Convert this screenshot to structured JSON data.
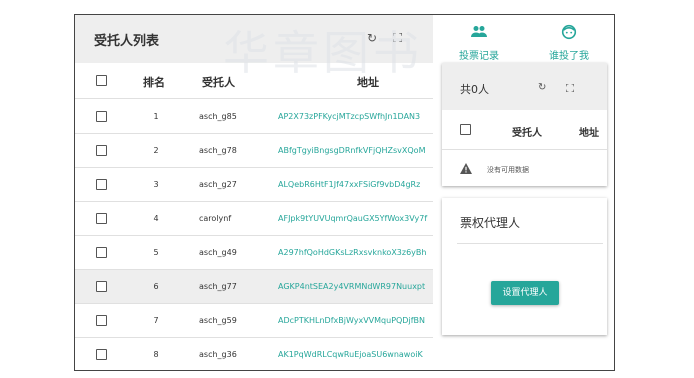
{
  "delegates": {
    "title": "受托人列表",
    "refresh_icon": "↻",
    "watermark": "华章图书",
    "columns": {
      "rank": "排名",
      "name": "受托人",
      "address": "地址"
    },
    "rows": [
      {
        "rank": "1",
        "name": "asch_g85",
        "address": "AP2X73zPFKycjMTzcpSWfhJn1DAN3"
      },
      {
        "rank": "2",
        "name": "asch_g78",
        "address": "ABfgTgyiBngsgDRnfkVFjQHZsvXQoM"
      },
      {
        "rank": "3",
        "name": "asch_g27",
        "address": "ALQebR6HtF1Jf47xxFSiGf9vbD4gRz"
      },
      {
        "rank": "4",
        "name": "carolynf",
        "address": "AFJpk9tYUVUqmrQauGX5YfWox3Vy7f"
      },
      {
        "rank": "5",
        "name": "asch_g49",
        "address": "A297hfQoHdGKsLzRxsvknkoX3z6yBh"
      },
      {
        "rank": "6",
        "name": "asch_g77",
        "address": "AGKP4ntSEA2y4VRMNdWR97Nuuxpt"
      },
      {
        "rank": "7",
        "name": "asch_g59",
        "address": "ADcPTKHLnDfxBjWyxVVMquPQDjfBN"
      },
      {
        "rank": "8",
        "name": "asch_g36",
        "address": "AK1PqWdRLCqwRuEjoaSU6wnawoiK"
      }
    ]
  },
  "tabs": [
    {
      "label": "投票记录",
      "icon": "people-icon"
    },
    {
      "label": "谁投了我",
      "icon": "face-icon"
    }
  ],
  "votes_card": {
    "title": "共0人",
    "refresh_icon": "↻",
    "columns": {
      "name": "受托人",
      "address": "地址"
    },
    "empty_text": "没有可用数据"
  },
  "proxy_card": {
    "title": "票权代理人",
    "button": "设置代理人"
  },
  "colors": {
    "accent": "#26a69a",
    "header_bg": "#eeeeee"
  }
}
